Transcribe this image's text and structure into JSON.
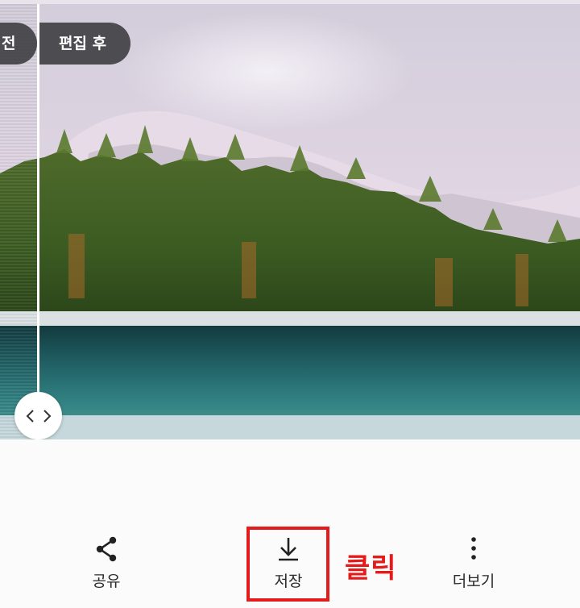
{
  "compare": {
    "before_label": "전",
    "after_label": "편집 후"
  },
  "actions": {
    "share_label": "공유",
    "save_label": "저장",
    "more_label": "더보기"
  },
  "annotation": {
    "text": "클릭",
    "color": "#e41b1b"
  },
  "icons": {
    "share": "share-icon",
    "save": "download-icon",
    "more": "more-vertical-icon",
    "handle": "chevron-left-right-icon"
  }
}
